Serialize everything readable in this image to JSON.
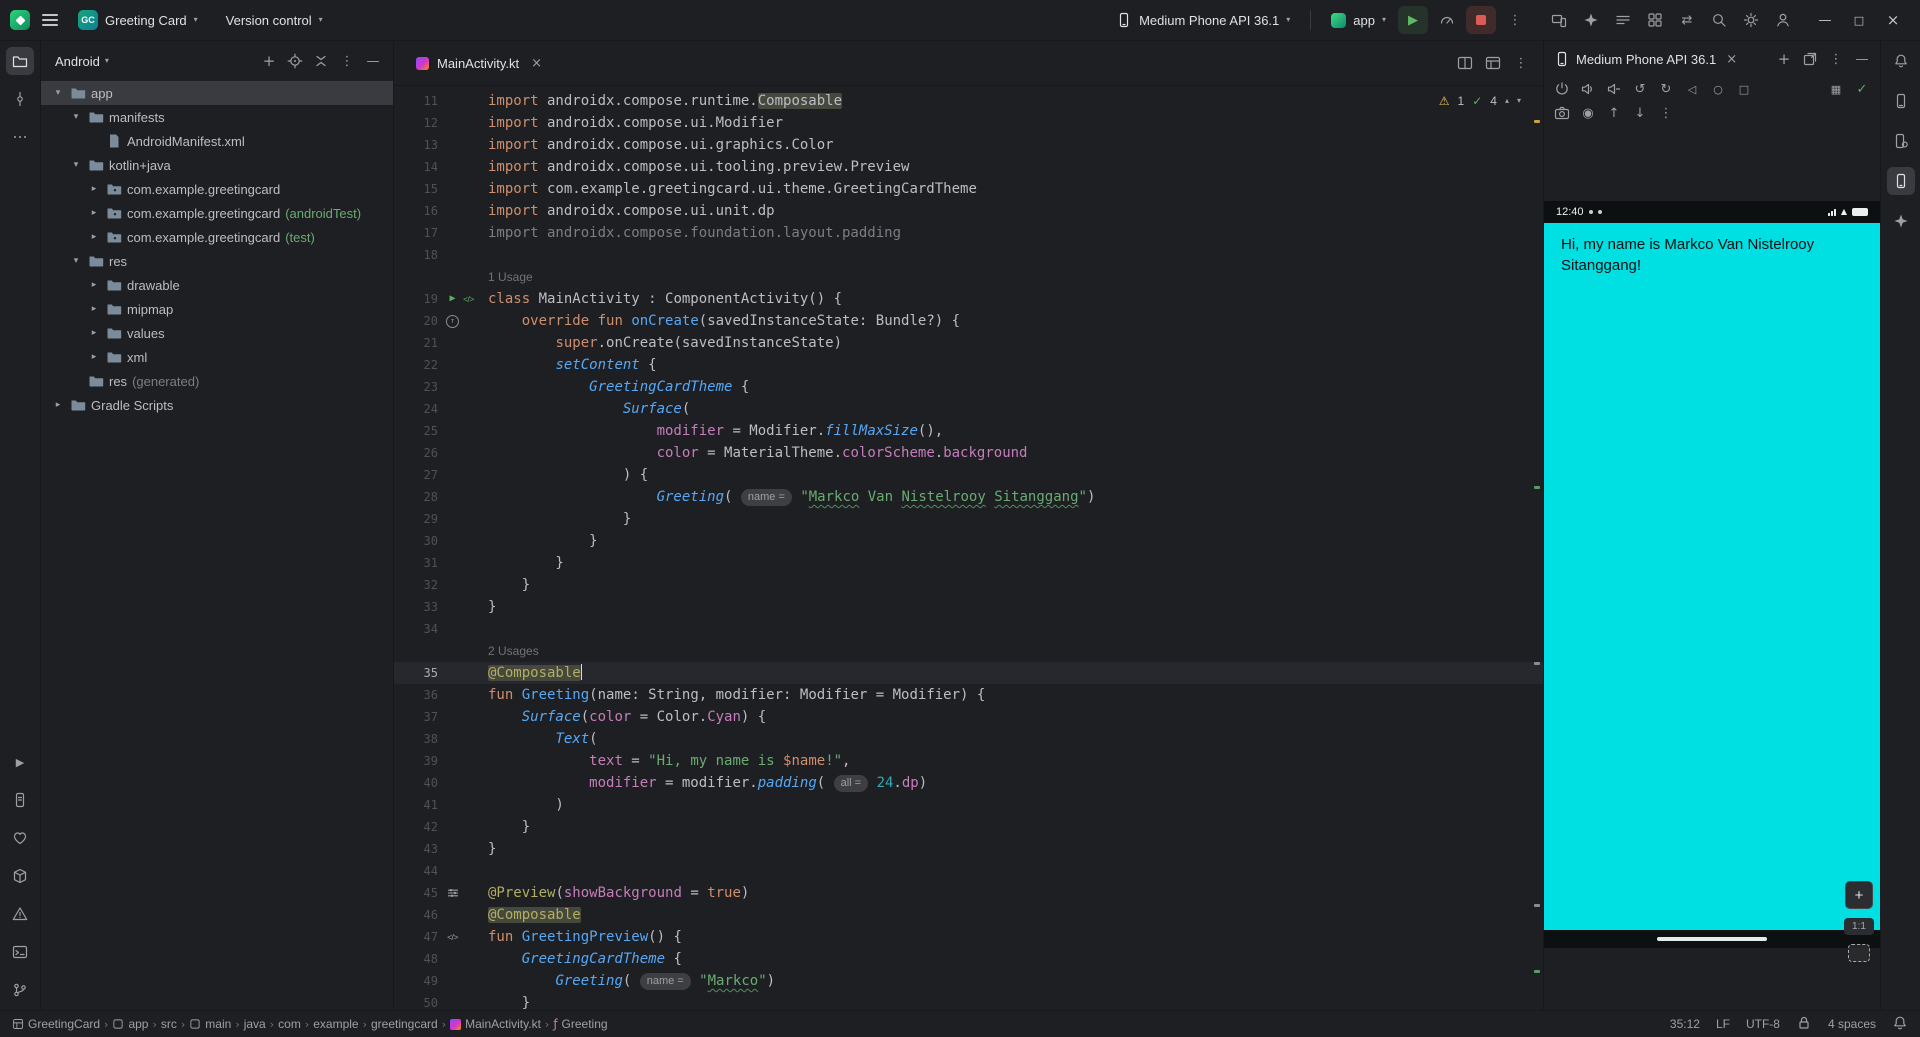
{
  "titlebar": {
    "project": {
      "badge": "GC",
      "name": "Greeting Card"
    },
    "vcs": "Version control",
    "run": {
      "device": "Medium Phone API 36.1",
      "config": "app"
    },
    "right_icons": [
      "device-mirroring",
      "gemini",
      "task-list",
      "plugins",
      "sync",
      "search",
      "settings",
      "profile"
    ],
    "window_controls": [
      "minimize",
      "maximize",
      "close"
    ]
  },
  "left_strip": {
    "top": [
      {
        "name": "project",
        "active": true
      },
      {
        "name": "commit"
      },
      {
        "name": "more-horizontal"
      }
    ],
    "bottom": [
      {
        "name": "run-tool"
      },
      {
        "name": "logcat"
      },
      {
        "name": "app-quality-insights"
      },
      {
        "name": "build"
      },
      {
        "name": "problems"
      },
      {
        "name": "terminal"
      },
      {
        "name": "version-control"
      }
    ]
  },
  "right_strip": [
    {
      "name": "notifications"
    },
    {
      "name": "device-explorer"
    },
    {
      "name": "device-manager"
    },
    {
      "name": "running-devices",
      "active": true
    },
    {
      "name": "gemini"
    }
  ],
  "project_panel": {
    "title": "Android",
    "header_icons": [
      "add",
      "locate",
      "collapse-all",
      "more",
      "hide"
    ],
    "tree": [
      {
        "label": "app",
        "level": 0,
        "chevron": "down",
        "icon": "folder",
        "selected": true
      },
      {
        "label": "manifests",
        "level": 1,
        "chevron": "down",
        "icon": "folder"
      },
      {
        "label": "AndroidManifest.xml",
        "level": 2,
        "chevron": "none",
        "icon": "file"
      },
      {
        "label": "kotlin+java",
        "level": 1,
        "chevron": "down",
        "icon": "folder"
      },
      {
        "label": "com.example.greetingcard",
        "level": 2,
        "chevron": "right",
        "icon": "package"
      },
      {
        "label": "com.example.greetingcard",
        "suffix": " (androidTest)",
        "sfx": "green",
        "level": 2,
        "chevron": "right",
        "icon": "package"
      },
      {
        "label": "com.example.greetingcard",
        "suffix": " (test)",
        "sfx": "green",
        "level": 2,
        "chevron": "right",
        "icon": "package"
      },
      {
        "label": "res",
        "level": 1,
        "chevron": "down",
        "icon": "folder"
      },
      {
        "label": "drawable",
        "level": 2,
        "chevron": "right",
        "icon": "folder"
      },
      {
        "label": "mipmap",
        "level": 2,
        "chevron": "right",
        "icon": "folder"
      },
      {
        "label": "values",
        "level": 2,
        "chevron": "right",
        "icon": "folder"
      },
      {
        "label": "xml",
        "level": 2,
        "chevron": "right",
        "icon": "folder"
      },
      {
        "label": "res",
        "suffix": " (generated)",
        "sfx": "dim",
        "level": 1,
        "chevron": "none",
        "icon": "folder"
      },
      {
        "label": "Gradle Scripts",
        "level": 0,
        "chevron": "right",
        "icon": "folder"
      }
    ]
  },
  "editor": {
    "tab": {
      "label": "MainActivity.kt",
      "icon": "kotlin"
    },
    "tab_icons": [
      "split",
      "layout",
      "more"
    ],
    "inspection": {
      "warning_count": "1",
      "ok_count": "4"
    },
    "rows": [
      {
        "n": "11",
        "t": [
          [
            "kw",
            "import"
          ],
          [
            "d",
            " androidx.compose.runtime."
          ],
          [
            "hl",
            "Composable"
          ]
        ]
      },
      {
        "n": "12",
        "t": [
          [
            "kw",
            "import"
          ],
          [
            "d",
            " androidx.compose.ui.Modifier"
          ]
        ]
      },
      {
        "n": "13",
        "t": [
          [
            "kw",
            "import"
          ],
          [
            "d",
            " androidx.compose.ui.graphics.Color"
          ]
        ]
      },
      {
        "n": "14",
        "t": [
          [
            "kw",
            "import"
          ],
          [
            "d",
            " androidx.compose.ui.tooling.preview.Preview"
          ]
        ]
      },
      {
        "n": "15",
        "t": [
          [
            "kw",
            "import"
          ],
          [
            "d",
            " com.example.greetingcard.ui.theme.GreetingCardTheme"
          ]
        ]
      },
      {
        "n": "16",
        "t": [
          [
            "kw",
            "import"
          ],
          [
            "d",
            " androidx.compose.ui.unit.dp"
          ]
        ]
      },
      {
        "n": "17",
        "t": [
          [
            "gray",
            "import androidx.compose.foundation.layout.padding"
          ]
        ]
      },
      {
        "n": "18",
        "t": []
      },
      {
        "inlay": "1 Usage"
      },
      {
        "n": "19",
        "g": [
          "run",
          "compose"
        ],
        "t": [
          [
            "kw",
            "class"
          ],
          [
            "d",
            " MainActivity : ComponentActivity() {"
          ]
        ]
      },
      {
        "n": "20",
        "g": [
          "override"
        ],
        "t": [
          [
            "d",
            "    "
          ],
          [
            "kw",
            "override"
          ],
          [
            "d",
            " "
          ],
          [
            "kw",
            "fun"
          ],
          [
            "d",
            " "
          ],
          [
            "fn",
            "onCreate"
          ],
          [
            "d",
            "(savedInstanceState: Bundle?) {"
          ]
        ]
      },
      {
        "n": "21",
        "t": [
          [
            "d",
            "        "
          ],
          [
            "kw",
            "super"
          ],
          [
            "d",
            ".onCreate(savedInstanceState)"
          ]
        ]
      },
      {
        "n": "22",
        "t": [
          [
            "d",
            "        "
          ],
          [
            "call",
            "setContent"
          ],
          [
            "d",
            " {"
          ]
        ]
      },
      {
        "n": "23",
        "t": [
          [
            "d",
            "            "
          ],
          [
            "call",
            "GreetingCardTheme"
          ],
          [
            "d",
            " {"
          ]
        ]
      },
      {
        "n": "24",
        "t": [
          [
            "d",
            "                "
          ],
          [
            "call",
            "Surface"
          ],
          [
            "d",
            "("
          ]
        ]
      },
      {
        "n": "25",
        "t": [
          [
            "d",
            "                    "
          ],
          [
            "prop",
            "modifier"
          ],
          [
            "d",
            " = Modifier."
          ],
          [
            "call",
            "fillMaxSize"
          ],
          [
            "d",
            "(),"
          ]
        ]
      },
      {
        "n": "26",
        "t": [
          [
            "d",
            "                    "
          ],
          [
            "prop",
            "color"
          ],
          [
            "d",
            " = MaterialTheme."
          ],
          [
            "prop",
            "colorScheme"
          ],
          [
            "d",
            "."
          ],
          [
            "prop",
            "background"
          ]
        ]
      },
      {
        "n": "27",
        "t": [
          [
            "d",
            "                ) {"
          ]
        ]
      },
      {
        "n": "28",
        "t": [
          [
            "d",
            "                    "
          ],
          [
            "call",
            "Greeting"
          ],
          [
            "d",
            "( "
          ],
          [
            "hint",
            "name ="
          ],
          [
            "d",
            " "
          ],
          [
            "str",
            "\""
          ],
          [
            "typo",
            "Markco"
          ],
          [
            "str",
            " Van "
          ],
          [
            "typo",
            "Nistelrooy"
          ],
          [
            "str",
            " "
          ],
          [
            "typo",
            "Sitanggang"
          ],
          [
            "str",
            "\""
          ],
          [
            "d",
            ")"
          ]
        ]
      },
      {
        "n": "29",
        "t": [
          [
            "d",
            "                }"
          ]
        ]
      },
      {
        "n": "30",
        "t": [
          [
            "d",
            "            }"
          ]
        ]
      },
      {
        "n": "31",
        "t": [
          [
            "d",
            "        }"
          ]
        ]
      },
      {
        "n": "32",
        "t": [
          [
            "d",
            "    }"
          ]
        ]
      },
      {
        "n": "33",
        "t": [
          [
            "d",
            "}"
          ]
        ]
      },
      {
        "n": "34",
        "t": []
      },
      {
        "inlay": "2 Usages"
      },
      {
        "n": "35",
        "active": true,
        "caret": true,
        "t": [
          [
            "annhl",
            "@Composable"
          ]
        ]
      },
      {
        "n": "36",
        "t": [
          [
            "kw",
            "fun"
          ],
          [
            "d",
            " "
          ],
          [
            "fn",
            "Greeting"
          ],
          [
            "d",
            "(name: String, modifier: Modifier = Modifier) {"
          ]
        ]
      },
      {
        "n": "37",
        "t": [
          [
            "d",
            "    "
          ],
          [
            "call",
            "Surface"
          ],
          [
            "d",
            "("
          ],
          [
            "prop",
            "color"
          ],
          [
            "d",
            " = Color."
          ],
          [
            "prop",
            "Cyan"
          ],
          [
            "d",
            ") {"
          ]
        ]
      },
      {
        "n": "38",
        "t": [
          [
            "d",
            "        "
          ],
          [
            "call",
            "Text"
          ],
          [
            "d",
            "("
          ]
        ]
      },
      {
        "n": "39",
        "t": [
          [
            "d",
            "            "
          ],
          [
            "prop",
            "text"
          ],
          [
            "d",
            " = "
          ],
          [
            "str",
            "\"Hi, my name is "
          ],
          [
            "strt",
            "$name"
          ],
          [
            "str",
            "!\""
          ],
          [
            "d",
            ","
          ]
        ]
      },
      {
        "n": "40",
        "t": [
          [
            "d",
            "            "
          ],
          [
            "prop",
            "modifier"
          ],
          [
            "d",
            " = modifier."
          ],
          [
            "call",
            "padding"
          ],
          [
            "d",
            "( "
          ],
          [
            "hint",
            "all ="
          ],
          [
            "d",
            " "
          ],
          [
            "num",
            "24"
          ],
          [
            "d",
            "."
          ],
          [
            "prop",
            "dp"
          ],
          [
            "d",
            ")"
          ]
        ]
      },
      {
        "n": "41",
        "t": [
          [
            "d",
            "        )"
          ]
        ]
      },
      {
        "n": "42",
        "t": [
          [
            "d",
            "    }"
          ]
        ]
      },
      {
        "n": "43",
        "t": [
          [
            "d",
            "}"
          ]
        ]
      },
      {
        "n": "44",
        "t": []
      },
      {
        "n": "45",
        "g": [
          "preview"
        ],
        "t": [
          [
            "ann",
            "@Preview"
          ],
          [
            "d",
            "("
          ],
          [
            "prop",
            "showBackground"
          ],
          [
            "d",
            " = "
          ],
          [
            "kw",
            "true"
          ],
          [
            "d",
            ")"
          ]
        ]
      },
      {
        "n": "46",
        "t": [
          [
            "annhl",
            "@Composable"
          ]
        ]
      },
      {
        "n": "47",
        "g": [
          "compose2"
        ],
        "t": [
          [
            "kw",
            "fun"
          ],
          [
            "d",
            " "
          ],
          [
            "fn",
            "GreetingPreview"
          ],
          [
            "d",
            "() {"
          ]
        ]
      },
      {
        "n": "48",
        "t": [
          [
            "d",
            "    "
          ],
          [
            "call",
            "GreetingCardTheme"
          ],
          [
            "d",
            " {"
          ]
        ]
      },
      {
        "n": "49",
        "t": [
          [
            "d",
            "        "
          ],
          [
            "call",
            "Greeting"
          ],
          [
            "d",
            "( "
          ],
          [
            "hint",
            "name ="
          ],
          [
            "d",
            " "
          ],
          [
            "str",
            "\""
          ],
          [
            "typo",
            "Markco"
          ],
          [
            "str",
            "\""
          ],
          [
            "d",
            ")"
          ]
        ]
      },
      {
        "n": "50",
        "t": [
          [
            "d",
            "    }"
          ]
        ]
      }
    ]
  },
  "device_panel": {
    "title": "Medium Phone API 36.1",
    "header_icons": [
      "add",
      "new-window",
      "more",
      "hide"
    ],
    "toolbar_row1": [
      "power",
      "volume-up",
      "volume-down",
      "rotate-left",
      "rotate-right",
      "back",
      "home",
      "overview"
    ],
    "toolbar_row1_right": [
      "snapshot",
      "status-check"
    ],
    "toolbar_row2": [
      "screenshot",
      "record",
      "upload",
      "download",
      "more"
    ],
    "screen": {
      "time": "12:40",
      "message": "Hi, my name is Markco Van Nistelrooy Sitanggang!",
      "color": "#00DFE2"
    },
    "zoom": {
      "plus": "+",
      "level": "1:1"
    }
  },
  "statusbar": {
    "separator": "›",
    "crumbs": [
      {
        "label": "GreetingCard",
        "icon": "project-grid"
      },
      {
        "label": "app",
        "icon": "module"
      },
      {
        "label": "src"
      },
      {
        "label": "main",
        "icon": "module"
      },
      {
        "label": "java"
      },
      {
        "label": "com"
      },
      {
        "label": "example"
      },
      {
        "label": "greetingcard"
      },
      {
        "label": "MainActivity.kt",
        "icon": "kotlin"
      },
      {
        "label": "Greeting",
        "icon": "function"
      }
    ],
    "caret_position": "35:12",
    "line_ending": "LF",
    "encoding": "UTF-8",
    "indent": "4 spaces"
  }
}
